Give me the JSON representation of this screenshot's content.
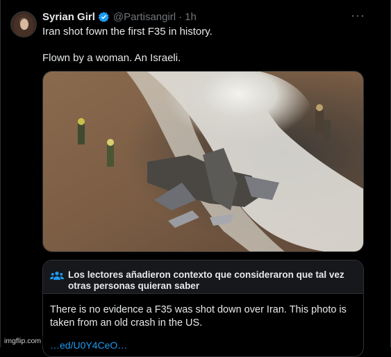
{
  "tweet": {
    "author_name": "Syrian Girl",
    "handle": "@Partisangirl",
    "separator": "·",
    "time": "1h",
    "more_label": "···",
    "text": "Iran shot fown the first F35 in history.\n\nFlown by a woman. An Israeli."
  },
  "community_note": {
    "title": "Los lectores añadieron contexto que consideraron que tal vez otras personas quieran saber",
    "body": "There is no evidence a F35 was shot down over Iran. This photo is taken from an old crash in the US.",
    "link": "…ed/U0Y4CeO…"
  },
  "watermark": "imgflip.com",
  "colors": {
    "background": "#000000",
    "text": "#e7e9ea",
    "muted": "#71767b",
    "verified": "#1d9bf0",
    "note_header": "#16181c"
  },
  "icons": {
    "verified": "verified-badge-icon",
    "more": "more-icon",
    "note": "people-icon"
  }
}
